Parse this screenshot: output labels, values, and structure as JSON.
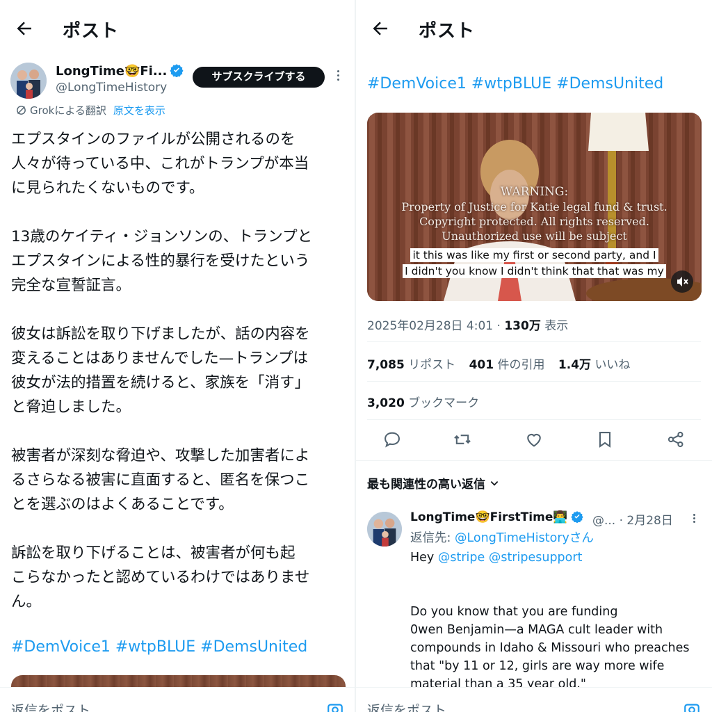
{
  "left": {
    "header": {
      "title": "ポスト"
    },
    "author": {
      "name": "LongTime🤓Fi...",
      "handle": "@LongTimeHistory",
      "subscribe_label": "サブスクライブする"
    },
    "translation": {
      "label": "Grokによる翻訳",
      "show_original": "原文を表示"
    },
    "body": "エプスタインのファイルが公開されるのを\n人々が待っている中、これがトランプが本当\nに見られたくないものです。\n\n13歳のケイティ・ジョンソンの、トランプと\nエプスタインによる性的暴行を受けたという\n完全な宣誓証言。\n\n彼女は訴訟を取り下げましたが、話の内容を\n変えることはありませんでした—トランプは\n彼女が法的措置を続けると、家族を「消す」\nと脅迫しました。\n\n被害者が深刻な脅迫や、攻撃した加害者によ\nるさらなる被害に直面すると、匿名を保つこ\nとを選ぶのはよくあることです。\n\n訴訟を取り下げることは、被害者が何も起\nこらなかったと認めているわけではありませ\nん。",
    "hashtags": "#DemVoice1 #wtpBLUE #DemsUnited",
    "reply_placeholder": "返信をポスト"
  },
  "right": {
    "header": {
      "title": "ポスト"
    },
    "hashtags": "#DemVoice1 #wtpBLUE #DemsUnited",
    "video": {
      "warning_lines": [
        "WARNING:",
        "Property of Justice for Katie legal fund & trust.",
        "Copyright protected. All rights reserved.",
        "Unauthorized use will be subject"
      ],
      "caption_lines": [
        "it this was like my first or second party, and I",
        "I didn't you know I didn't think that that was my"
      ]
    },
    "meta": {
      "datetime": "2025年02月28日 4:01",
      "sep": " · ",
      "views_count": "130万",
      "views_label": " 表示"
    },
    "stats": {
      "reposts_count": "7,085",
      "reposts_label": "リポスト",
      "quotes_count": "401",
      "quotes_label": "件の引用",
      "likes_count": "1.4万",
      "likes_label": "いいね",
      "bookmarks_count": "3,020",
      "bookmarks_label": "ブックマーク"
    },
    "relevance_label": "最も関連性の高い返信",
    "reply": {
      "name": "LongTime🤓FirstTime👨‍💻",
      "handle_date": "@... · 2月28日",
      "reply_to_prefix": "返信先: ",
      "reply_to_handle": "@LongTimeHistoryさん",
      "mention_prefix": "Hey ",
      "mentions": "@stripe @stripesupport",
      "body": "Do you know that you are funding\n0wen Benjamin—a MAGA cult leader with\ncompounds in Idaho & Missouri who preaches\nthat \"by 11 or 12, girls are way more wife\nmaterial than a 35 year old.\""
    },
    "reply_placeholder": "返信をポスト"
  },
  "icons": {
    "back": "arrow-left-icon",
    "verified": "verified-badge-icon",
    "grok": "grok-icon",
    "camera": "camera-icon",
    "mute": "volume-muted-icon",
    "reply": "comment-icon",
    "repost": "repost-icon",
    "like": "heart-icon",
    "bookmark": "bookmark-icon",
    "share": "share-icon"
  },
  "colors": {
    "accent": "#1d9bf0",
    "text": "#0f1419",
    "muted": "#536471",
    "divider": "#eff3f4"
  }
}
